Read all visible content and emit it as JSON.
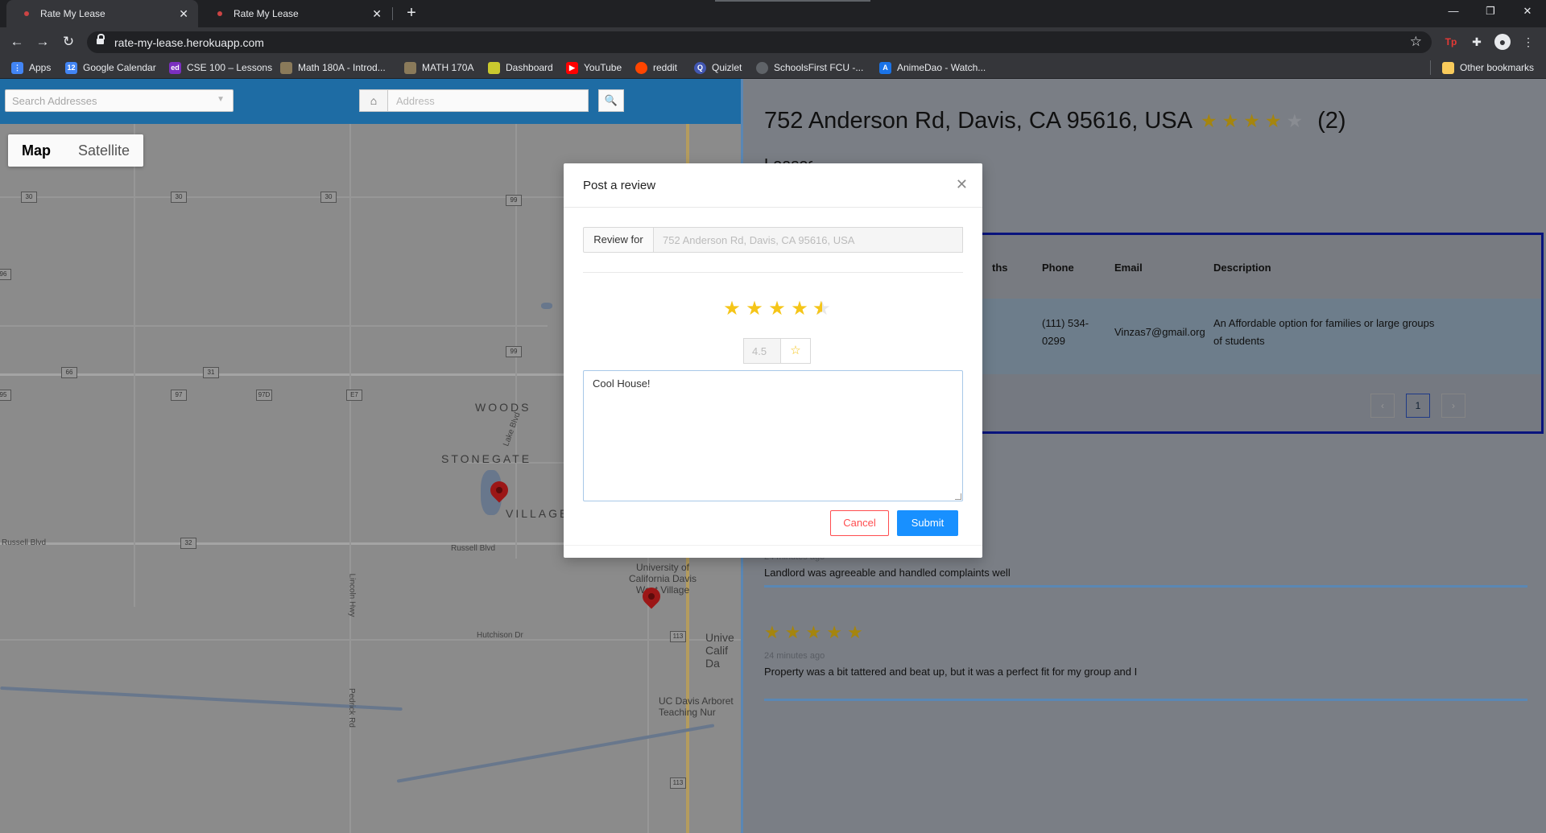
{
  "browser": {
    "tabs": [
      {
        "title": "Rate My Lease",
        "active": true
      },
      {
        "title": "Rate My Lease",
        "active": false
      }
    ],
    "url": "rate-my-lease.herokuapp.com",
    "bookmarks": [
      {
        "label": "Apps",
        "icon": "apps-grid-icon",
        "color": "#4285f4"
      },
      {
        "label": "Google Calendar",
        "icon": "calendar-icon",
        "color": "#4285f4"
      },
      {
        "label": "CSE 100 – Lessons",
        "icon": "ed-icon",
        "color": "#7b2fbf"
      },
      {
        "label": "Math 180A - Introd...",
        "icon": "page-icon",
        "color": "#8a7a5a"
      },
      {
        "label": "MATH 170A",
        "icon": "page-icon",
        "color": "#8a7a5a"
      },
      {
        "label": "Dashboard",
        "icon": "feather-icon",
        "color": "#c9c92e"
      },
      {
        "label": "YouTube",
        "icon": "youtube-icon",
        "color": "#ff0000"
      },
      {
        "label": "reddit",
        "icon": "reddit-icon",
        "color": "#ff4500"
      },
      {
        "label": "Quizlet",
        "icon": "quizlet-icon",
        "color": "#4257b2"
      },
      {
        "label": "SchoolsFirst FCU -...",
        "icon": "globe-icon",
        "color": "#5f6368"
      },
      {
        "label": "AnimeDao - Watch...",
        "icon": "animedao-icon",
        "color": "#1a73e8"
      }
    ],
    "other_bookmarks": "Other bookmarks"
  },
  "map": {
    "search_addresses_placeholder": "Search Addresses",
    "address_placeholder": "Address",
    "map_type": [
      "Map",
      "Satellite"
    ],
    "labels": {
      "woods": "WOODS",
      "stonegate": "STONEGATE",
      "village": "VILLAGE",
      "russell_blvd_left": "Russell Blvd",
      "russell_blvd": "Russell Blvd",
      "lake_blvd": "Lake Blvd",
      "hutchison_dr": "Hutchison Dr",
      "lincoln_hwy": "Lincoln Hwy",
      "pedrick_rd": "Pedrick Rd",
      "uc_davis": "University of California Davis West Village",
      "univ_calif_da": "Unive Calif Da",
      "arboretum": "UC Davis Arboret Teaching Nur"
    },
    "shields": [
      "30",
      "30",
      "30",
      "99",
      "99",
      "66",
      "31",
      "97",
      "97D",
      "E7",
      "96",
      "95",
      "32",
      "113",
      "113"
    ]
  },
  "property": {
    "address": "752 Anderson Rd, Davis, CA 95616, USA",
    "rating": 4,
    "review_count": "(2)",
    "leases_heading": "Leases",
    "table": {
      "headers": [
        "ths",
        "Phone",
        "Email",
        "Description"
      ],
      "row": {
        "phone": "(111) 534-0299",
        "email": "Vinzas7@gmail.org",
        "description": "An Affordable option for families or large groups of students"
      },
      "page": "1"
    },
    "reviews": [
      {
        "stars": 5,
        "time": "24 minutes ago",
        "text": "Landlord was agreeable and handled complaints well"
      },
      {
        "stars": 5,
        "time": "24 minutes ago",
        "text": "Property was a bit tattered and beat up, but it was a perfect fit for my group and I"
      }
    ]
  },
  "modal": {
    "title": "Post a review",
    "review_for_label": "Review for",
    "review_for_value": "752 Anderson Rd, Davis, CA 95616, USA",
    "rating": 4.5,
    "rating_display": "4.5",
    "review_text": "Cool House!",
    "cancel_label": "Cancel",
    "submit_label": "Submit"
  }
}
